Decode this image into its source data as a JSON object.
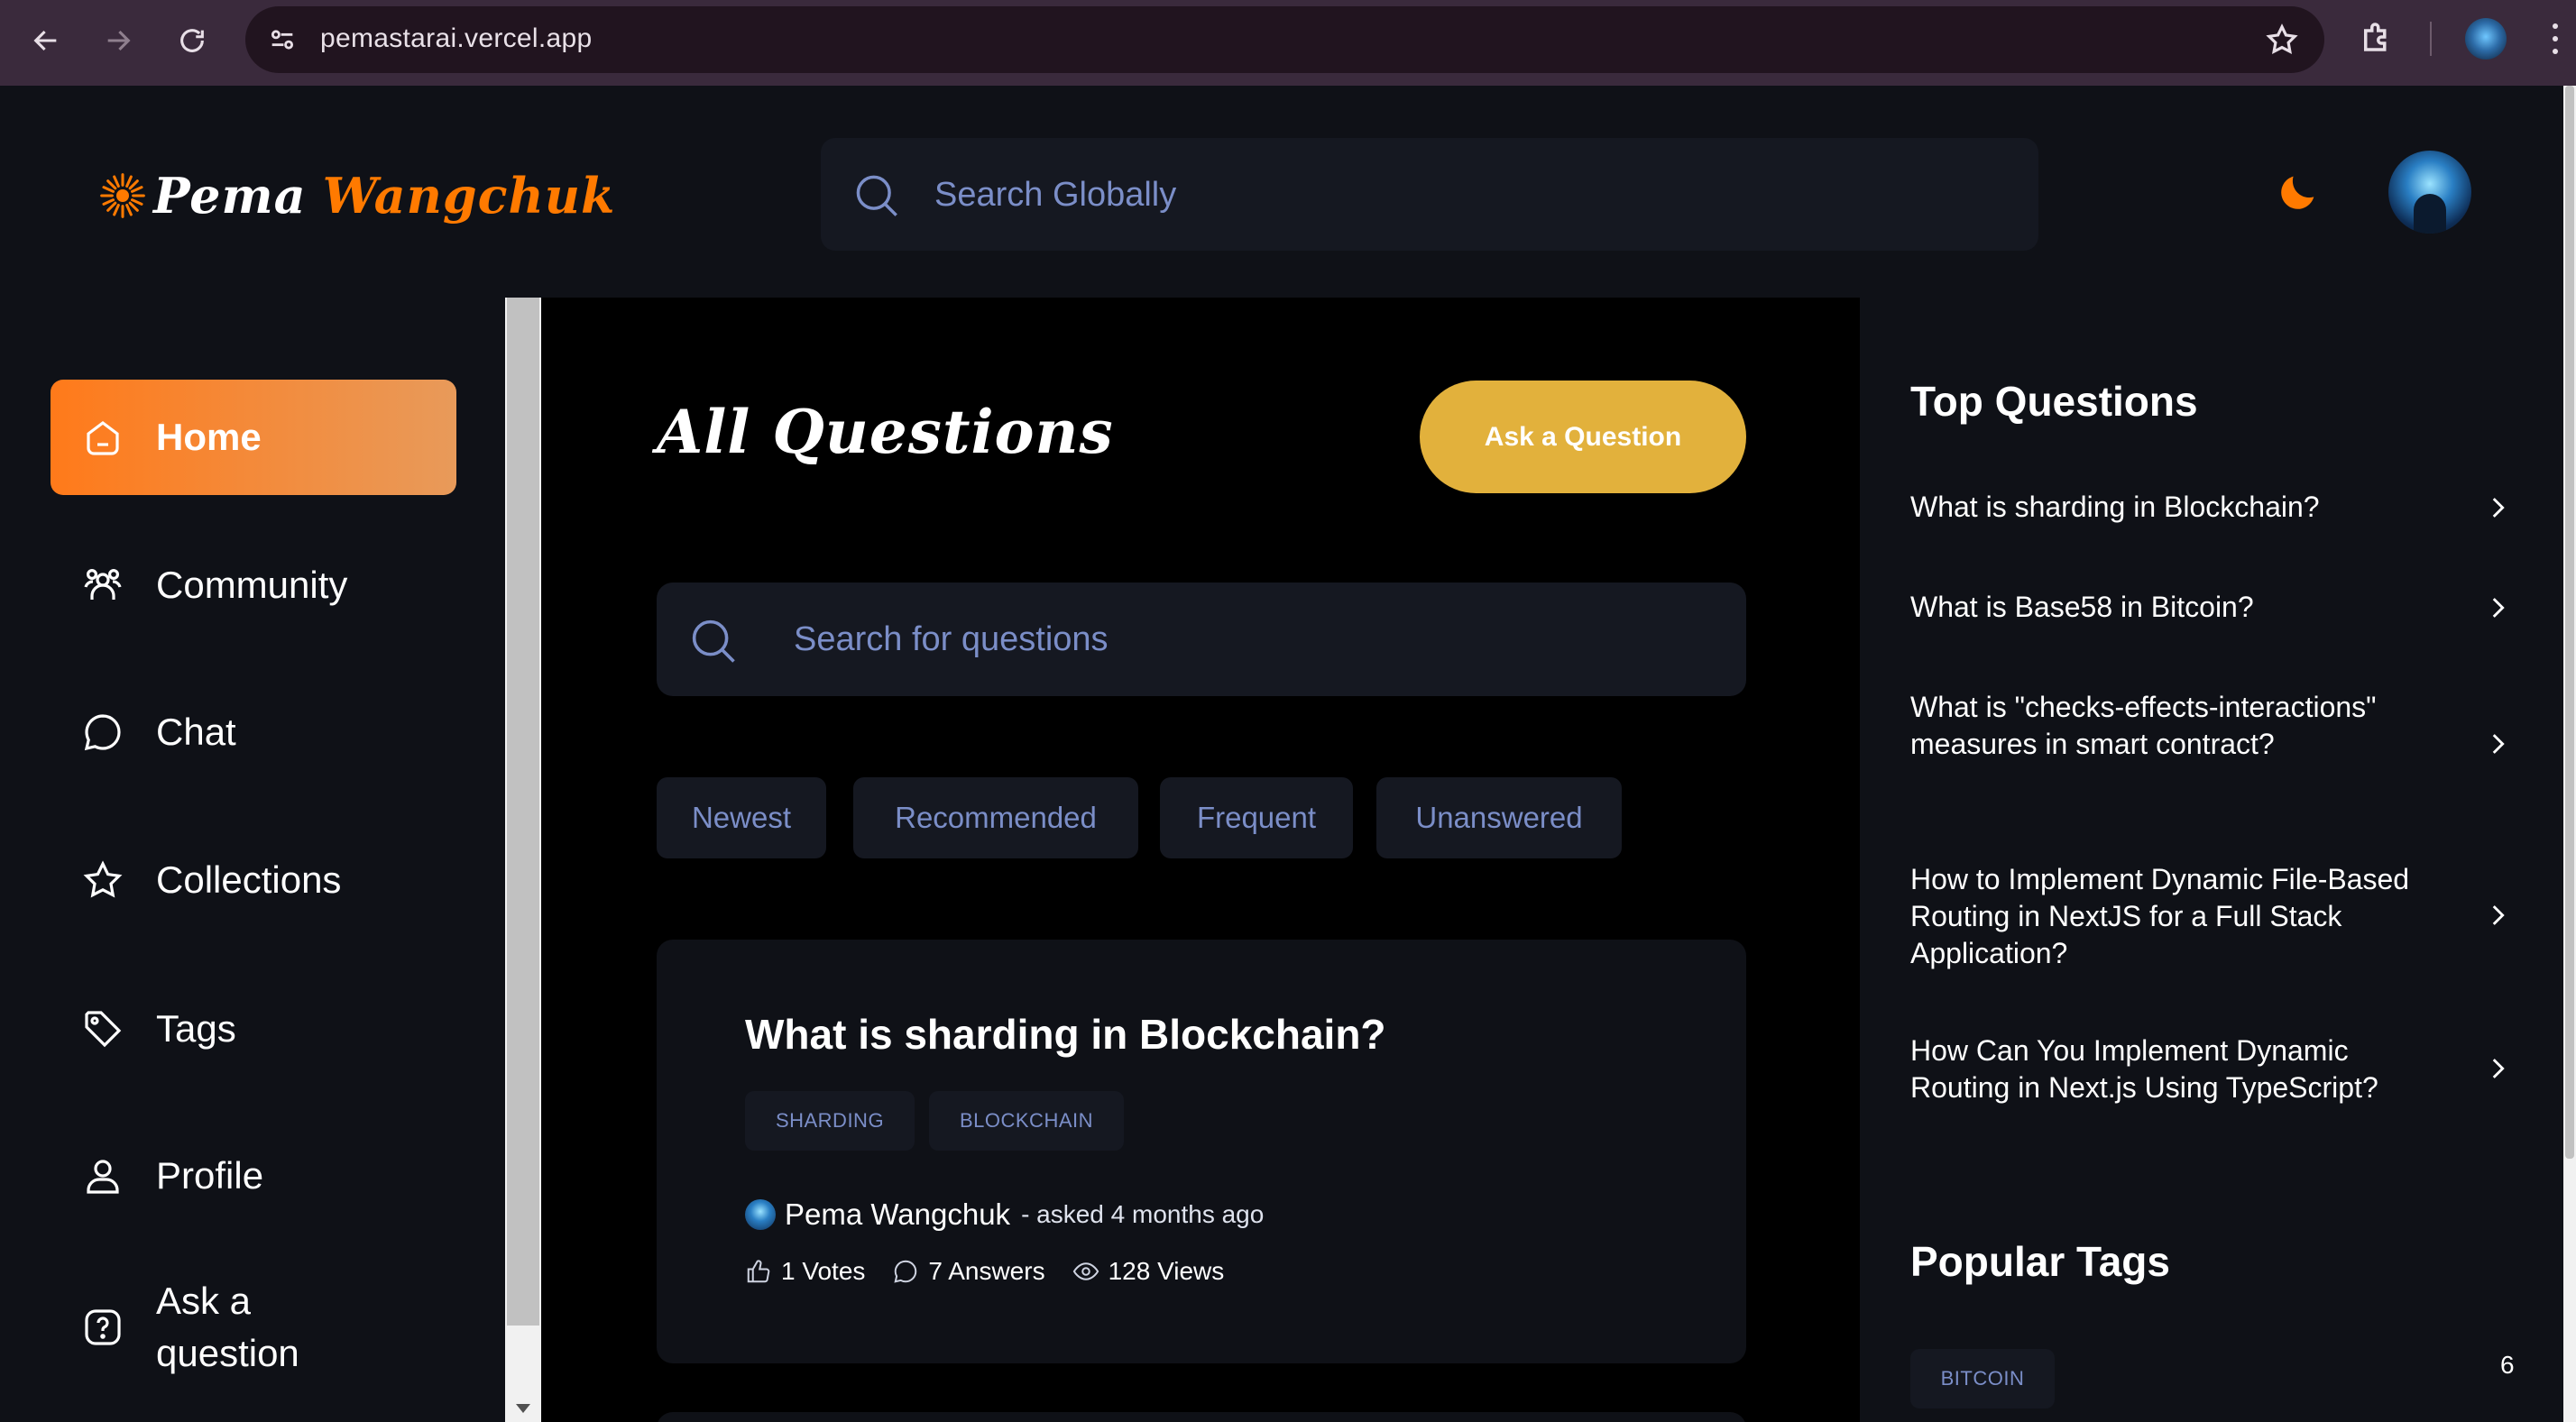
{
  "browser": {
    "url": "pemastarai.vercel.app"
  },
  "header": {
    "logo_first": "Pema",
    "logo_second": "Wangchuk",
    "search_placeholder": "Search Globally"
  },
  "sidebar": {
    "items": [
      {
        "label": "Home",
        "icon": "home-icon",
        "active": true
      },
      {
        "label": "Community",
        "icon": "community-icon"
      },
      {
        "label": "Chat",
        "icon": "chat-icon"
      },
      {
        "label": "Collections",
        "icon": "star-icon"
      },
      {
        "label": "Tags",
        "icon": "tag-icon"
      },
      {
        "label": "Profile",
        "icon": "user-icon"
      },
      {
        "label_line1": "Ask a",
        "label_line2": "question",
        "icon": "question-icon"
      }
    ]
  },
  "main": {
    "title": "All Questions",
    "ask_button": "Ask a Question",
    "search_placeholder": "Search for questions",
    "filters": [
      "Newest",
      "Recommended",
      "Frequent",
      "Unanswered"
    ],
    "question": {
      "title": "What is sharding in Blockchain?",
      "tags": [
        "SHARDING",
        "BLOCKCHAIN"
      ],
      "author": "Pema Wangchuk",
      "asked": "- asked 4 months ago",
      "votes": "1 Votes",
      "answers": "7 Answers",
      "views": "128 Views"
    }
  },
  "right": {
    "top_title": "Top Questions",
    "top_questions": [
      "What is sharding in Blockchain?",
      "What is Base58 in Bitcoin?",
      "What is \"checks-effects-interactions\" measures in smart contract?",
      "How to Implement Dynamic File-Based Routing in NextJS for a Full Stack Application?",
      "How Can You Implement Dynamic Routing in Next.js Using TypeScript?"
    ],
    "tags_title": "Popular Tags",
    "popular_tags": [
      {
        "name": "BITCOIN",
        "count": "6"
      }
    ]
  },
  "colors": {
    "accent": "#ff7a00",
    "ask_button": "#e2b13c",
    "muted_text": "#7b8ec8",
    "panel": "#0f1117"
  }
}
